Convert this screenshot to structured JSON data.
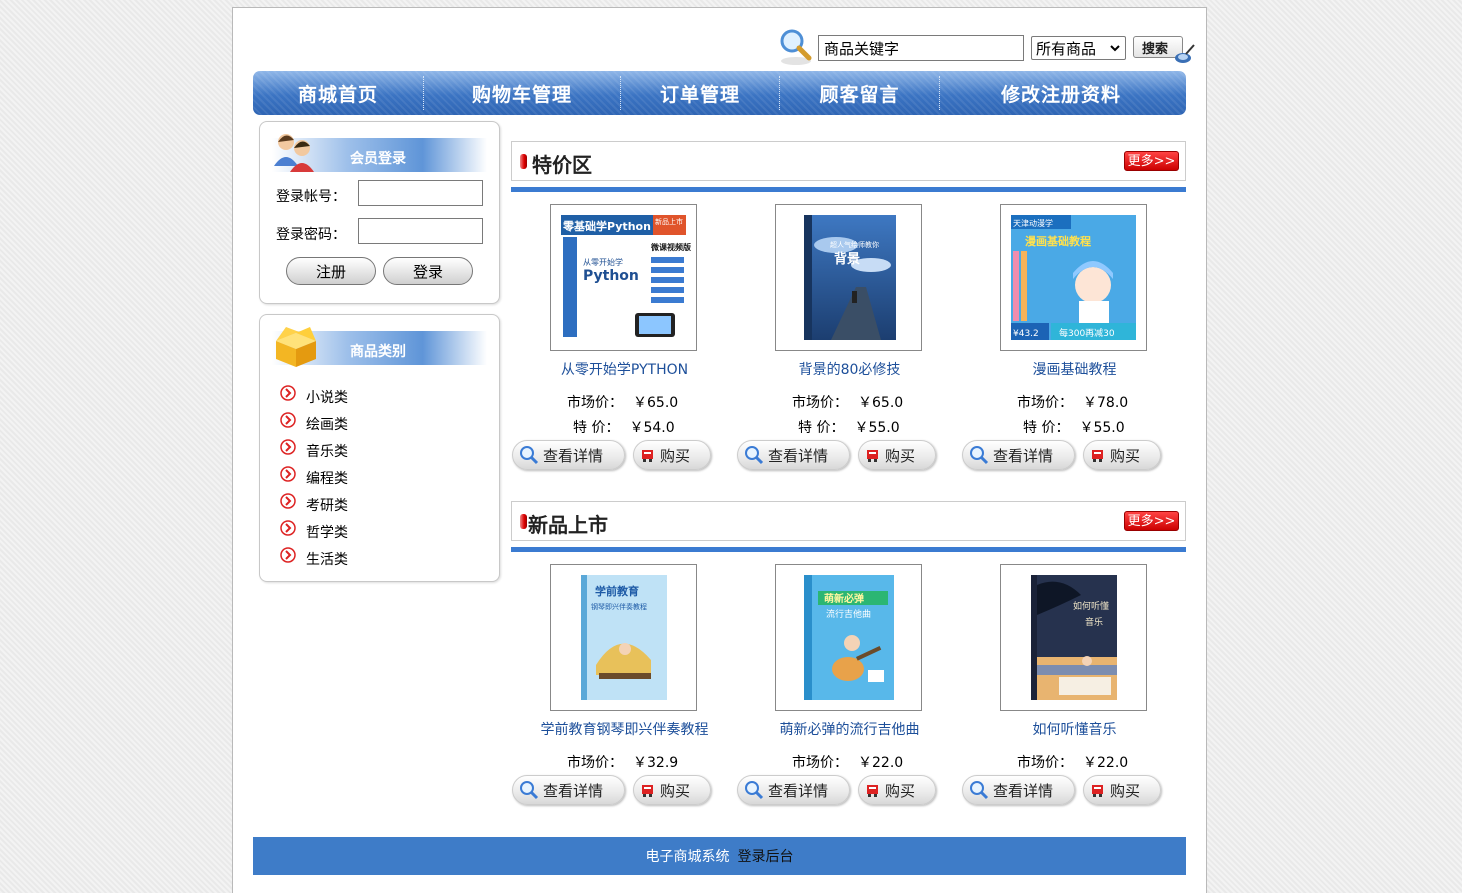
{
  "search": {
    "keyword_value": "商品关键字",
    "category_selected": "所有商品",
    "button_label": "搜索"
  },
  "nav": [
    {
      "label": "商城首页"
    },
    {
      "label": "购物车管理"
    },
    {
      "label": "订单管理"
    },
    {
      "label": "顾客留言"
    },
    {
      "label": "修改注册资料"
    }
  ],
  "login": {
    "title": "会员登录",
    "account_label": "登录帐号：",
    "password_label": "登录密码：",
    "register_label": "注册",
    "login_label": "登录"
  },
  "categories": {
    "title": "商品类别",
    "items": [
      "小说类",
      "绘画类",
      "音乐类",
      "编程类",
      "考研类",
      "哲学类",
      "生活类"
    ]
  },
  "specials": {
    "title": "特价区",
    "more_label": "更多>>",
    "products": [
      {
        "name": "从零开始学PYTHON",
        "market_label": "市场价：",
        "market_price": "￥65.0",
        "special_label": "特 价：",
        "special_price": "￥54.0"
      },
      {
        "name": "背景的80必修技",
        "market_label": "市场价：",
        "market_price": "￥65.0",
        "special_label": "特 价：",
        "special_price": "￥55.0"
      },
      {
        "name": "漫画基础教程",
        "market_label": "市场价：",
        "market_price": "￥78.0",
        "special_label": "特 价：",
        "special_price": "￥55.0"
      }
    ]
  },
  "new_arrivals": {
    "title": "新品上市",
    "more_label": "更多>>",
    "products": [
      {
        "name": "学前教育钢琴即兴伴奏教程",
        "market_label": "市场价：",
        "market_price": "￥32.9"
      },
      {
        "name": "萌新必弹的流行吉他曲",
        "market_label": "市场价：",
        "market_price": "￥22.0"
      },
      {
        "name": "如何听懂音乐",
        "market_label": "市场价：",
        "market_price": "￥22.0"
      }
    ]
  },
  "actions": {
    "detail_label": "查看详情",
    "buy_label": "购买"
  },
  "covers": {
    "p1": {
      "banner": "零基础学Python",
      "tag": "新品上市",
      "sub": "从零开始学",
      "big": "Python",
      "ed": "微课视频版"
    },
    "p2": {
      "line1": "超人气绘师教你",
      "line2": "背景"
    },
    "p3": {
      "banner": "天津动漫学",
      "title": "漫画基础教程",
      "price": "¥43.2",
      "promo": "每300再减30"
    },
    "p4": {
      "t1": "学前教育",
      "t2": "钢琴即兴伴奏教程"
    },
    "p5": {
      "t1": "萌新必弹",
      "t2": "流行吉他曲"
    },
    "p6": {
      "t1": "如何听懂",
      "t2": "音乐"
    }
  },
  "footer": {
    "system_label": "电子商城系统",
    "admin_label": "登录后台"
  },
  "colors": {
    "nav_blue": "#3b74c3",
    "section_line": "#3b7bd1",
    "footer_blue": "#3e7cc8",
    "link_blue": "#1d4f9a",
    "more_red": "#d00000"
  }
}
